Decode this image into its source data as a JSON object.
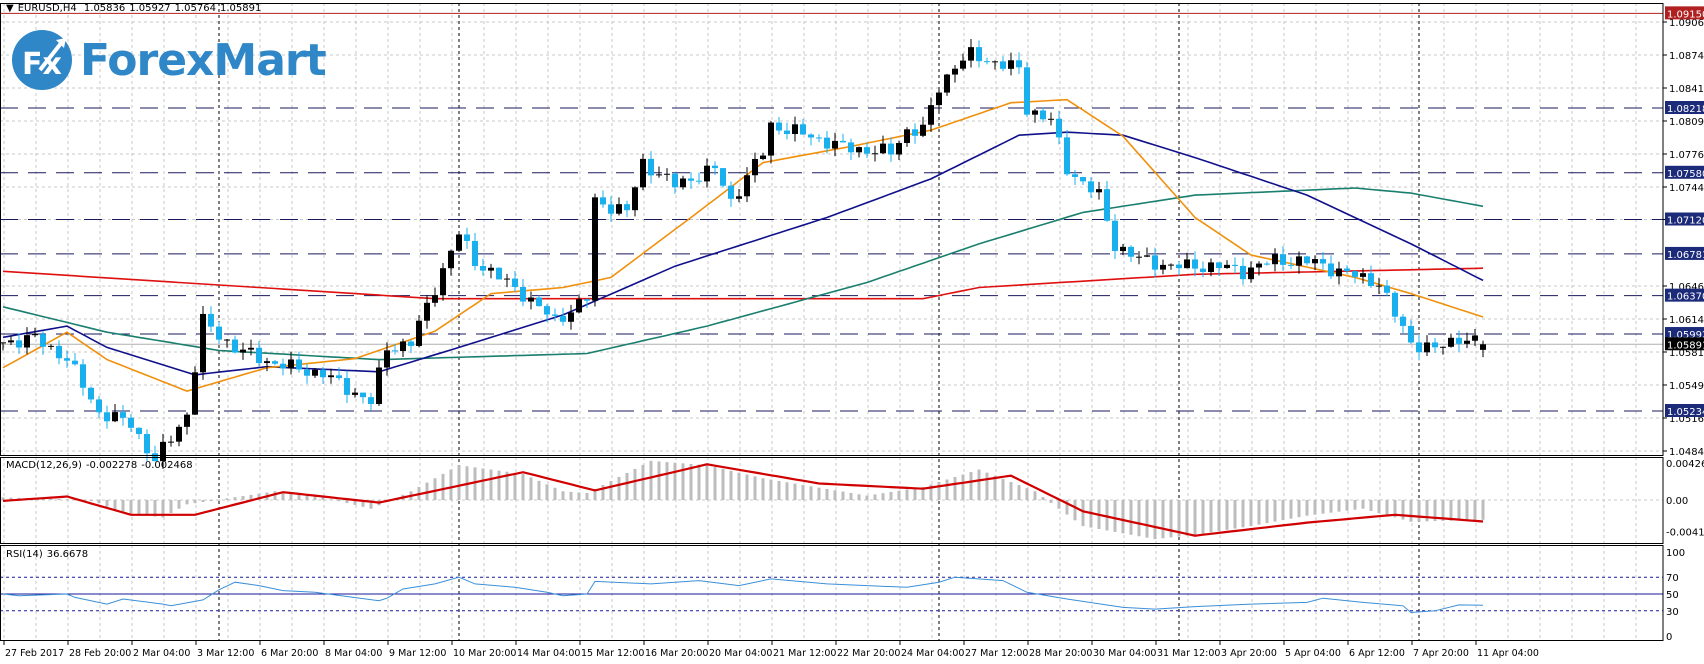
{
  "header": {
    "symbol": "EURUSD,H4",
    "open": "1.05836",
    "high": "1.05927",
    "low": "1.05764",
    "close": "1.05891"
  },
  "logo": {
    "text": "ForexMart",
    "badge": "Fx"
  },
  "macd_title": {
    "name": "MACD(12,26,9)",
    "main": "-0.002278",
    "signal": "-0.002468"
  },
  "rsi_title": {
    "name": "RSI(14)",
    "value": "36.6678"
  },
  "colors": {
    "bull": "#000000",
    "bear": "#1ab0ee",
    "ma_red": "#e01010",
    "ma_teal": "#1a7f6e",
    "ma_blue": "#10108a",
    "ma_orange": "#f0900c",
    "level": "#1a1a5e",
    "level_label": "#1c2a7a",
    "resistance": "#b02020",
    "macd_hist": "#bdbdbd",
    "macd_signal": "#d00000",
    "rsi": "#3a8fd8",
    "rsi_levels": "#1a1a9a"
  },
  "chart_data": {
    "type": "candlestick",
    "title": "EURUSD,H4",
    "bars": 186,
    "ylim": [
      1.0484,
      1.0918
    ],
    "price_ticks": [
      "1.09065",
      "1.08740",
      "1.08415",
      "1.08090",
      "1.07765",
      "1.07440",
      "1.07120",
      "1.06465",
      "1.06140",
      "1.05815",
      "1.05490",
      "1.05165",
      "1.04840"
    ],
    "levels": [
      "1.08218",
      "1.07580",
      "1.07120",
      "1.06781",
      "1.06370",
      "1.05992",
      "1.05234"
    ],
    "resistance_level": "1.09150",
    "current_price": "1.05891",
    "last_bar": {
      "open": 1.05836,
      "high": 1.05927,
      "low": 1.05764,
      "close": 1.05891
    },
    "close_path": [
      [
        0,
        1.0591
      ],
      [
        4,
        1.0595
      ],
      [
        8,
        1.0575
      ],
      [
        12,
        1.0522
      ],
      [
        16,
        1.0511
      ],
      [
        19,
        1.0474
      ],
      [
        23,
        1.052
      ],
      [
        25,
        1.0612
      ],
      [
        29,
        1.0585
      ],
      [
        34,
        1.057
      ],
      [
        40,
        1.056
      ],
      [
        46,
        1.0532
      ],
      [
        48,
        1.0586
      ],
      [
        51,
        1.059
      ],
      [
        54,
        1.0645
      ],
      [
        57,
        1.0698
      ],
      [
        59,
        1.0671
      ],
      [
        65,
        1.0639
      ],
      [
        69,
        1.0612
      ],
      [
        73,
        1.0634
      ],
      [
        74,
        1.073
      ],
      [
        78,
        1.072
      ],
      [
        80,
        1.0768
      ],
      [
        84,
        1.0746
      ],
      [
        89,
        1.0762
      ],
      [
        91,
        1.073
      ],
      [
        95,
        1.0778
      ],
      [
        96,
        1.0805
      ],
      [
        101,
        1.0794
      ],
      [
        105,
        1.0783
      ],
      [
        111,
        1.0778
      ],
      [
        113,
        1.08
      ],
      [
        115,
        1.08
      ],
      [
        117,
        1.0842
      ],
      [
        119,
        1.0864
      ],
      [
        121,
        1.0874
      ],
      [
        127,
        1.086
      ],
      [
        128,
        1.0821
      ],
      [
        131,
        1.081
      ],
      [
        133,
        1.0762
      ],
      [
        137,
        1.0735
      ],
      [
        139,
        1.0687
      ],
      [
        142,
        1.0673
      ],
      [
        146,
        1.0666
      ],
      [
        152,
        1.0666
      ],
      [
        155,
        1.0661
      ],
      [
        159,
        1.0672
      ],
      [
        164,
        1.067
      ],
      [
        167,
        1.0661
      ],
      [
        172,
        1.065
      ],
      [
        174,
        1.0618
      ],
      [
        176,
        1.0591
      ],
      [
        179,
        1.0584
      ],
      [
        182,
        1.0596
      ],
      [
        185,
        1.05891
      ]
    ],
    "ma_series": [
      {
        "name": "ma_red",
        "points": [
          [
            0,
            1.0661
          ],
          [
            54,
            1.0634
          ],
          [
            115,
            1.0634
          ],
          [
            122,
            1.0645
          ],
          [
            149,
            1.0658
          ],
          [
            185,
            1.0664
          ]
        ]
      },
      {
        "name": "ma_teal",
        "points": [
          [
            0,
            1.0626
          ],
          [
            13,
            1.0601
          ],
          [
            27,
            1.0583
          ],
          [
            47,
            1.0574
          ],
          [
            73,
            1.058
          ],
          [
            88,
            1.0607
          ],
          [
            108,
            1.065
          ],
          [
            122,
            1.0688
          ],
          [
            135,
            1.0719
          ],
          [
            149,
            1.0736
          ],
          [
            169,
            1.0743
          ],
          [
            176,
            1.0738
          ],
          [
            185,
            1.0725
          ]
        ]
      },
      {
        "name": "ma_blue",
        "points": [
          [
            0,
            1.0596
          ],
          [
            8,
            1.0607
          ],
          [
            13,
            1.0586
          ],
          [
            24,
            1.0559
          ],
          [
            33,
            1.0567
          ],
          [
            47,
            1.0562
          ],
          [
            57,
            1.0586
          ],
          [
            70,
            1.0618
          ],
          [
            84,
            1.0666
          ],
          [
            103,
            1.0714
          ],
          [
            116,
            1.0752
          ],
          [
            127,
            1.0795
          ],
          [
            133,
            1.0798
          ],
          [
            140,
            1.0795
          ],
          [
            149,
            1.0773
          ],
          [
            163,
            1.0736
          ],
          [
            176,
            1.0688
          ],
          [
            185,
            1.0652
          ]
        ]
      },
      {
        "name": "ma_orange",
        "points": [
          [
            0,
            1.0566
          ],
          [
            8,
            1.0601
          ],
          [
            13,
            1.0574
          ],
          [
            23,
            1.0543
          ],
          [
            33,
            1.0566
          ],
          [
            44,
            1.0575
          ],
          [
            54,
            1.0602
          ],
          [
            61,
            1.0639
          ],
          [
            70,
            1.0645
          ],
          [
            76,
            1.0655
          ],
          [
            86,
            1.0714
          ],
          [
            95,
            1.0768
          ],
          [
            106,
            1.0784
          ],
          [
            116,
            1.08
          ],
          [
            126,
            1.0827
          ],
          [
            133,
            1.083
          ],
          [
            140,
            1.0794
          ],
          [
            149,
            1.0714
          ],
          [
            156,
            1.0677
          ],
          [
            169,
            1.0655
          ],
          [
            176,
            1.0639
          ],
          [
            185,
            1.0616
          ]
        ]
      }
    ],
    "separators": [
      27,
      57,
      117,
      147,
      177
    ],
    "time_labels": [
      "27 Feb 2017",
      "28 Feb 20:00",
      "2 Mar 04:00",
      "3 Mar 12:00",
      "6 Mar 20:00",
      "8 Mar 04:00",
      "9 Mar 12:00",
      "10 Mar 20:00",
      "14 Mar 04:00",
      "15 Mar 12:00",
      "16 Mar 20:00",
      "20 Mar 04:00",
      "21 Mar 12:00",
      "22 Mar 20:00",
      "24 Mar 04:00",
      "27 Mar 12:00",
      "28 Mar 20:00",
      "30 Mar 04:00",
      "31 Mar 12:00",
      "3 Apr 20:00",
      "5 Apr 04:00",
      "6 Apr 12:00",
      "7 Apr 20:00",
      "11 Apr 04:00"
    ],
    "macd": {
      "ticks": [
        "0.004261",
        "0.00",
        "-0.004108"
      ],
      "ylim": [
        -0.004108,
        0.004261
      ],
      "histogram": [
        [
          0,
          0.0003
        ],
        [
          11,
          0.0
        ],
        [
          15,
          -0.0015
        ],
        [
          20,
          -0.002
        ],
        [
          23,
          -0.0005
        ],
        [
          34,
          0.001
        ],
        [
          40,
          0.0003
        ],
        [
          46,
          -0.001
        ],
        [
          51,
          0.001
        ],
        [
          57,
          0.004
        ],
        [
          65,
          0.003
        ],
        [
          70,
          0.001
        ],
        [
          73,
          0.0008
        ],
        [
          81,
          0.0045
        ],
        [
          88,
          0.004
        ],
        [
          95,
          0.0025
        ],
        [
          108,
          0.0005
        ],
        [
          115,
          0.0015
        ],
        [
          122,
          0.0035
        ],
        [
          129,
          0.001
        ],
        [
          135,
          -0.003
        ],
        [
          144,
          -0.0045
        ],
        [
          149,
          -0.004
        ],
        [
          156,
          -0.003
        ],
        [
          163,
          -0.0018
        ],
        [
          170,
          -0.001
        ],
        [
          176,
          -0.0025
        ],
        [
          185,
          -0.002278
        ]
      ],
      "signal": [
        [
          0,
          -0.0001
        ],
        [
          8,
          0.0004
        ],
        [
          16,
          -0.0017
        ],
        [
          24,
          -0.0017
        ],
        [
          35,
          0.0009
        ],
        [
          47,
          -0.0003
        ],
        [
          65,
          0.0032
        ],
        [
          74,
          0.0011
        ],
        [
          88,
          0.0041
        ],
        [
          102,
          0.0019
        ],
        [
          115,
          0.0013
        ],
        [
          126,
          0.0028
        ],
        [
          135,
          -0.0013
        ],
        [
          149,
          -0.0041
        ],
        [
          163,
          -0.0026
        ],
        [
          174,
          -0.0017
        ],
        [
          185,
          -0.002468
        ]
      ]
    },
    "rsi": {
      "ticks": [
        "100",
        "70",
        "50",
        "30",
        "0"
      ],
      "levels": [
        70,
        50,
        30
      ],
      "ylim": [
        0,
        100
      ],
      "values": [
        [
          0,
          50
        ],
        [
          2,
          48
        ],
        [
          8,
          50
        ],
        [
          9,
          46
        ],
        [
          13,
          38
        ],
        [
          15,
          44
        ],
        [
          20,
          38
        ],
        [
          21,
          36
        ],
        [
          25,
          43
        ],
        [
          27,
          55
        ],
        [
          29,
          64
        ],
        [
          32,
          60
        ],
        [
          35,
          54
        ],
        [
          39,
          52
        ],
        [
          43,
          47
        ],
        [
          47,
          42
        ],
        [
          48,
          45
        ],
        [
          50,
          56
        ],
        [
          54,
          62
        ],
        [
          57,
          70
        ],
        [
          59,
          62
        ],
        [
          64,
          58
        ],
        [
          68,
          52
        ],
        [
          70,
          48
        ],
        [
          73,
          50
        ],
        [
          74,
          65
        ],
        [
          81,
          62
        ],
        [
          87,
          66
        ],
        [
          92,
          60
        ],
        [
          96,
          68
        ],
        [
          103,
          62
        ],
        [
          113,
          58
        ],
        [
          117,
          64
        ],
        [
          119,
          70
        ],
        [
          125,
          66
        ],
        [
          128,
          52
        ],
        [
          133,
          44
        ],
        [
          140,
          34
        ],
        [
          144,
          32
        ],
        [
          149,
          35
        ],
        [
          156,
          38
        ],
        [
          163,
          40
        ],
        [
          165,
          45
        ],
        [
          170,
          40
        ],
        [
          175,
          36
        ],
        [
          176,
          28
        ],
        [
          179,
          30
        ],
        [
          182,
          37
        ],
        [
          185,
          36.6678
        ]
      ]
    }
  }
}
